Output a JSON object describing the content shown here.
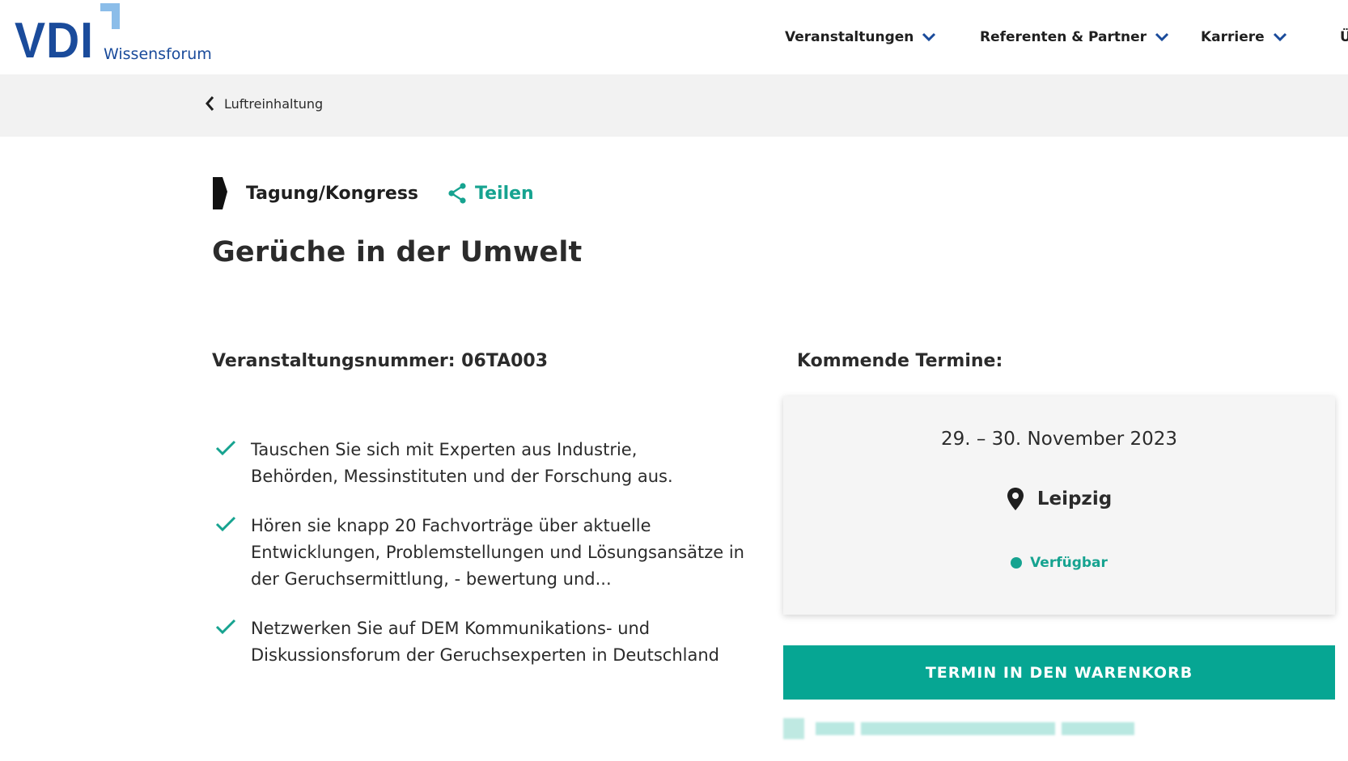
{
  "header": {
    "logo_main": "VDI",
    "logo_sub": "Wissensforum",
    "logo_corner_color": "#8bbde9",
    "brand_color": "#1a4b9b",
    "nav": [
      {
        "label": "Veranstaltungen",
        "icon": "chevron-down-icon"
      },
      {
        "label": "Referenten & Partner",
        "icon": "chevron-down-icon"
      },
      {
        "label": "Karriere",
        "icon": "chevron-down-icon"
      },
      {
        "label": "Ü",
        "icon": ""
      }
    ]
  },
  "breadcrumb": {
    "back_label": "Luftreinhaltung",
    "icon": "chevron-left-icon"
  },
  "event": {
    "type_label": "Tagung/Kongress",
    "share_label": "Teilen",
    "title": "Gerüche in der Umwelt",
    "number_label": "Veranstaltungsnummer: 06TA003",
    "bullets": [
      {
        "line1": "Tauschen Sie sich mit Experten aus Industrie,",
        "line2": "Behörden, Messinstituten und der Forschung aus.",
        "line3": ""
      },
      {
        "line1": "Hören sie knapp 20 Fachvorträge über aktuelle",
        "line2": "Entwicklungen, Problemstellungen und Lösungsansätze in",
        "line3": "der Geruchsermittlung, - bewertung und..."
      },
      {
        "line1": "Netzwerken Sie auf DEM Kommunikations- und",
        "line2": "Diskussionsforum der Geruchsexperten in Deutschland",
        "line3": ""
      }
    ]
  },
  "upcoming": {
    "title": "Kommende Termine:",
    "date": "29. – 30. November 2023",
    "location": "Leipzig",
    "availability": "Verfügbar",
    "cart_button": "TERMIN IN DEN WARENKORB"
  },
  "colors": {
    "accent": "#06a693",
    "text": "#2b2b2b",
    "band": "#f2f2f2"
  }
}
